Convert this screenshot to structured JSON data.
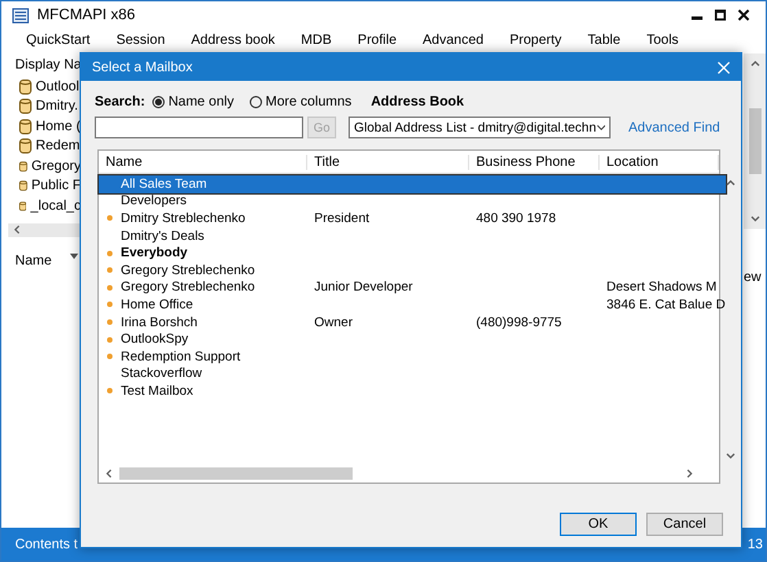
{
  "window": {
    "title": "MFCMAPI x86"
  },
  "menu": [
    "QuickStart",
    "Session",
    "Address book",
    "MDB",
    "Profile",
    "Advanced",
    "Property",
    "Table",
    "Tools"
  ],
  "left_pane": {
    "header": "Display Na",
    "items": [
      "Outlool",
      "Dmitry.",
      "Home (",
      "Redem",
      "Gregory",
      "Public F",
      "_local_c"
    ],
    "column_header": "Name"
  },
  "right_pane": {
    "fragment": "ew"
  },
  "status_bar": {
    "text": "Contents t",
    "count": "13"
  },
  "dialog": {
    "title": "Select a Mailbox",
    "search_label": "Search:",
    "search_options": [
      {
        "label": "Name only",
        "selected": true
      },
      {
        "label": "More columns",
        "selected": false
      }
    ],
    "go_button": {
      "label": "Go",
      "disabled": true
    },
    "address_book_label": "Address Book",
    "address_book": "Global Address List - dmitry@digital.techn",
    "advanced_find": "Advanced Find",
    "table": {
      "columns": [
        "Name",
        "Title",
        "Business Phone",
        "Location"
      ],
      "rows": [
        {
          "name": "All Sales Team",
          "dot": false,
          "bold": false,
          "selected": true
        },
        {
          "name": "Developers",
          "dot": false,
          "bold": false,
          "selected": false
        },
        {
          "name": "Dmitry Streblechenko",
          "title": "President",
          "business_phone": "480 390 1978",
          "dot": true,
          "bold": false,
          "selected": false
        },
        {
          "name": "Dmitry's Deals",
          "dot": false,
          "bold": false,
          "selected": false
        },
        {
          "name": "Everybody",
          "dot": true,
          "bold": true,
          "selected": false
        },
        {
          "name": "Gregory Streblechenko",
          "dot": true,
          "bold": false,
          "selected": false
        },
        {
          "name": "Gregory Streblechenko",
          "title": "Junior Developer",
          "location": "Desert Shadows M",
          "dot": true,
          "bold": false,
          "selected": false
        },
        {
          "name": "Home Office",
          "location": "3846 E. Cat Balue D",
          "dot": true,
          "bold": false,
          "selected": false
        },
        {
          "name": "Irina Borshch",
          "title": "Owner",
          "business_phone": "(480)998-9775",
          "dot": true,
          "bold": false,
          "selected": false
        },
        {
          "name": "OutlookSpy",
          "dot": true,
          "bold": false,
          "selected": false
        },
        {
          "name": "Redemption Support",
          "dot": true,
          "bold": false,
          "selected": false
        },
        {
          "name": "Stackoverflow",
          "dot": false,
          "bold": false,
          "selected": false
        },
        {
          "name": "Test Mailbox",
          "dot": true,
          "bold": false,
          "selected": false
        }
      ]
    },
    "buttons": [
      {
        "label": "OK",
        "default": true
      },
      {
        "label": "Cancel",
        "default": false
      }
    ]
  }
}
